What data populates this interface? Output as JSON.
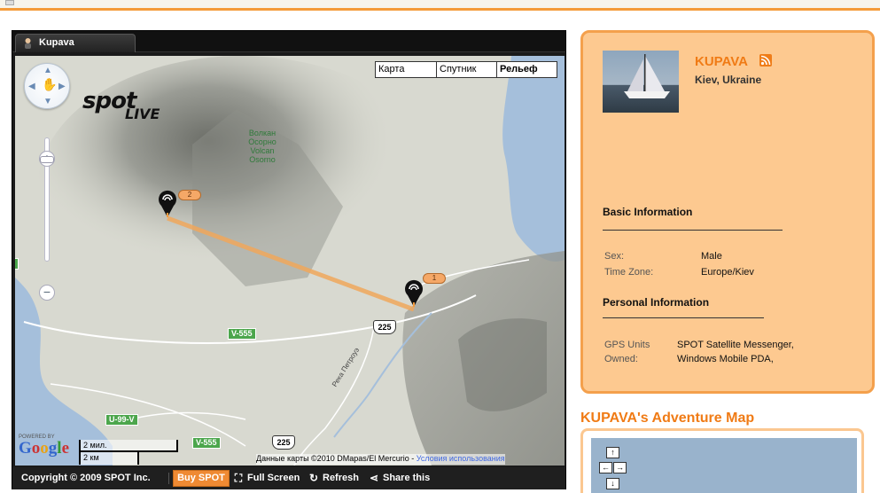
{
  "widget": {
    "tab_label": "Kupava",
    "map_types": [
      "Карта",
      "Спутник",
      "Рельеф"
    ],
    "active_map_type": "Рельеф",
    "spot_logo": "spot",
    "spot_logo_sub": "LIVE",
    "volcano_label": "Волкан Осорно Volcan Osorno",
    "markers": [
      {
        "num": "2"
      },
      {
        "num": "1"
      }
    ],
    "roads": [
      "V-555",
      "U-99-V",
      "V-555"
    ],
    "route_shields": [
      "225",
      "225"
    ],
    "river_label": "Река Петроуэ",
    "google_powered": "POWERED BY",
    "google_logo": "Google",
    "scale_miles": "2 мил.",
    "scale_km": "2 км",
    "attribution": "Данные карты ©2010 DMapas/El Mercurio - ",
    "terms_link": "Условия использования",
    "copyright": "Copyright © 2009 SPOT Inc.",
    "buy_button": "Buy SPOT",
    "fullscreen": "Full Screen",
    "refresh": "Refresh",
    "share": "Share this"
  },
  "profile": {
    "name": "KUPAVA",
    "location": "Kiev, Ukraine",
    "basic_info_title": "Basic Information",
    "sex_label": "Sex:",
    "sex_value": "Male",
    "timezone_label": "Time Zone:",
    "timezone_value": "Europe/Kiev",
    "personal_info_title": "Personal Information",
    "gps_label_1": "GPS Units",
    "gps_label_2": "Owned:",
    "gps_value_1": "SPOT Satellite Messenger,",
    "gps_value_2": "Windows Mobile PDA,"
  },
  "adventure": {
    "title": "KUPAVA's Adventure Map"
  },
  "colors": {
    "accent": "#f07b15",
    "panel": "#fdc990",
    "route": "#f0a75c"
  }
}
